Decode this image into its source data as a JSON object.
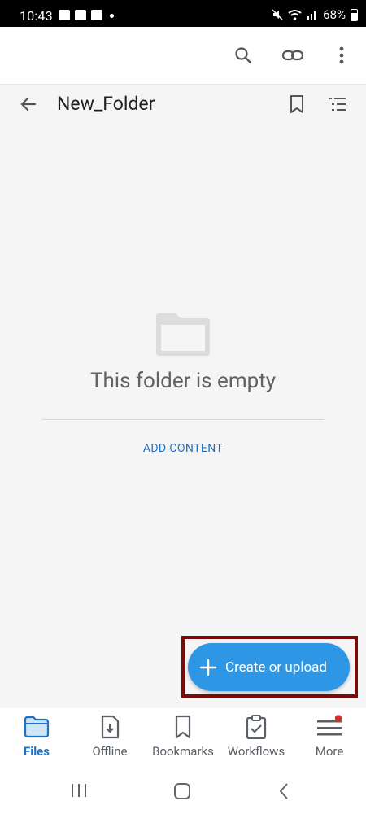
{
  "status_bar": {
    "time": "10:43",
    "battery": "68%"
  },
  "folder": {
    "title": "New_Folder"
  },
  "empty_state": {
    "message": "This folder is empty",
    "action": "ADD CONTENT"
  },
  "fab": {
    "label": "Create or upload"
  },
  "bottom_nav": [
    {
      "label": "Files",
      "icon": "folder-icon",
      "active": true
    },
    {
      "label": "Offline",
      "icon": "offline-download-icon"
    },
    {
      "label": "Bookmarks",
      "icon": "bookmark-icon"
    },
    {
      "label": "Workflows",
      "icon": "clipboard-check-icon"
    },
    {
      "label": "More",
      "icon": "menu-icon",
      "badge": true
    }
  ],
  "colors": {
    "accent": "#1b73c7",
    "fab": "#2e97e5",
    "highlight": "#7a0b0b",
    "badge": "#d32f2f"
  }
}
